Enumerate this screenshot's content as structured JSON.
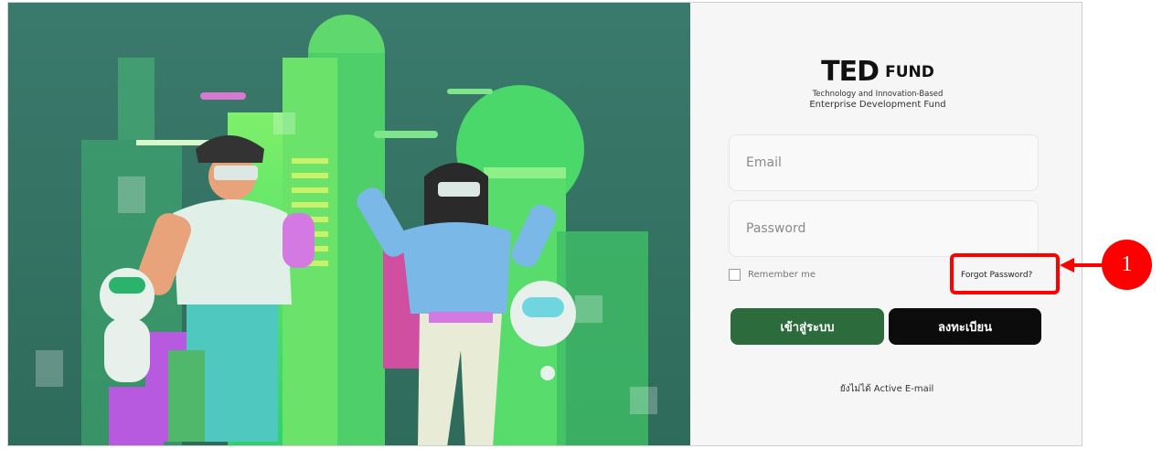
{
  "logo": {
    "mark": "TED",
    "fund": "FUND",
    "subtitle_line1": "Technology and Innovation-Based",
    "subtitle_line2": "Enterprise Development Fund"
  },
  "form": {
    "email_placeholder": "Email",
    "password_placeholder": "Password",
    "remember_label": "Remember me",
    "forgot_label": "Forgot Password?",
    "login_label": "เข้าสู่ระบบ",
    "register_label": "ลงทะเบียน",
    "active_email_label": "ยังไม่ได้ Active E-mail"
  },
  "annotation": {
    "number": "1"
  },
  "colors": {
    "login_button": "#2b6b3c",
    "register_button": "#0c0c0c",
    "annotation": "#ff0000",
    "hero_background": "#3f7d69"
  }
}
